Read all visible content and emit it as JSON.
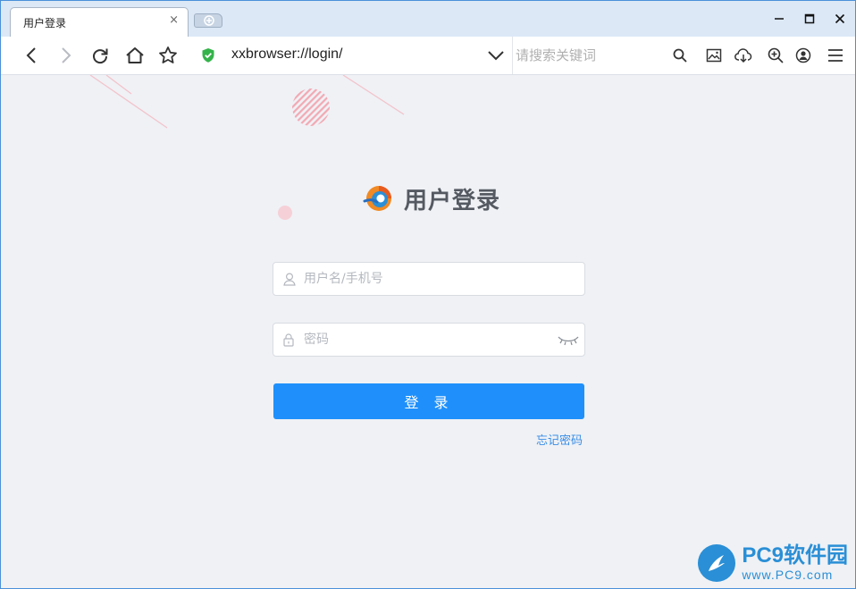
{
  "window": {
    "tab_title": "用户登录",
    "tab_close": "×"
  },
  "toolbar": {
    "url": "xxbrowser://login/",
    "search_placeholder": "请搜索关键词"
  },
  "login": {
    "title": "用户登录",
    "username_placeholder": "用户名/手机号",
    "password_placeholder": "密码",
    "submit_label": "登 录",
    "forgot_label": "忘记密码"
  },
  "watermark": {
    "main": "PC9软件园",
    "sub": "www.PC9.com"
  },
  "colors": {
    "primary": "#1f90fb",
    "page_bg": "#eff1f5",
    "title": "#555a62",
    "link": "#3a8ee6",
    "secure_shield": "#34b34a",
    "tabbar_bg": "#dce8f6"
  },
  "icons": {
    "back": "arrow-left",
    "forward": "arrow-right",
    "reload": "circular-arrow",
    "home": "house",
    "favorite": "star",
    "secure": "shield-check",
    "dropdown": "chevron-down",
    "search": "magnifier",
    "screenshot": "picture",
    "download": "cloud-download",
    "zoom": "magnifier-plus",
    "account": "person-circle",
    "menu": "hamburger",
    "user": "person-outline",
    "lock": "padlock",
    "eye_closed": "closed-eye"
  }
}
